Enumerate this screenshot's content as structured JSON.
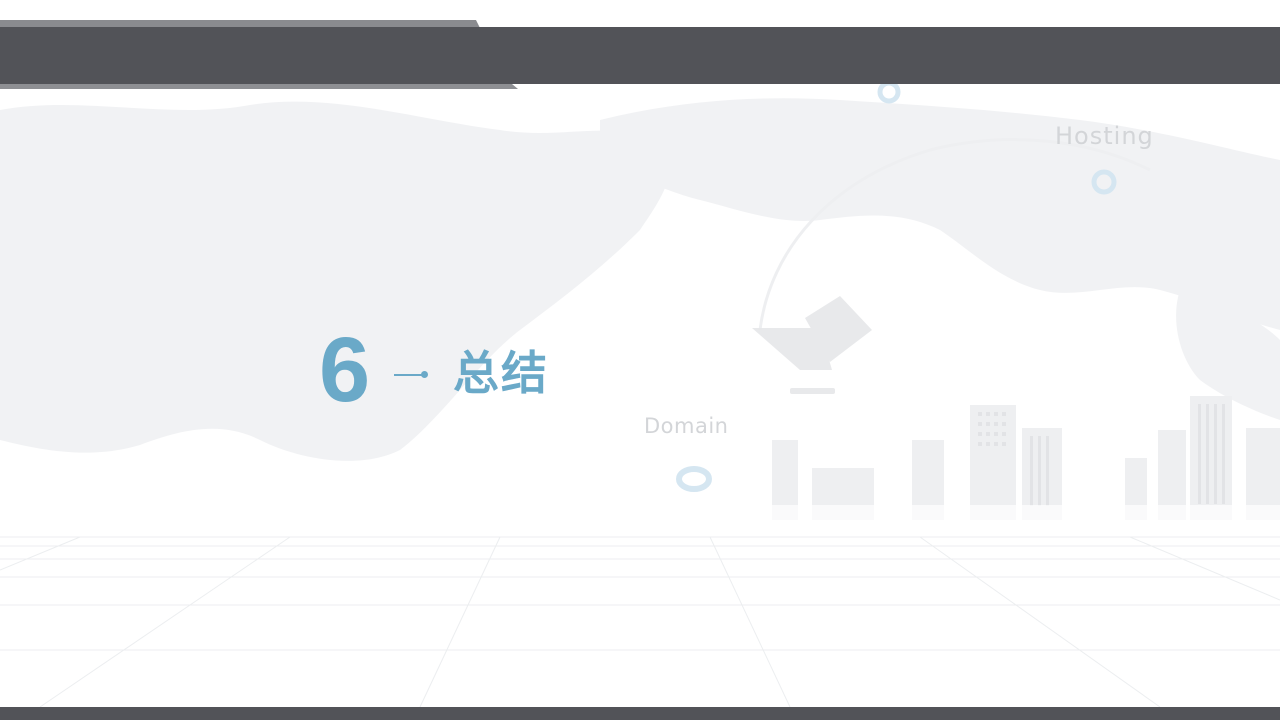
{
  "section": {
    "number": "6",
    "title": "总结"
  },
  "background": {
    "labels": {
      "hosting": "Hosting",
      "domain": "Domain"
    }
  },
  "colors": {
    "accent": "#6aa9c8",
    "bar": "#525358",
    "bar_light": "#8a8b8f",
    "watermark_text": "#d3d5d8"
  }
}
